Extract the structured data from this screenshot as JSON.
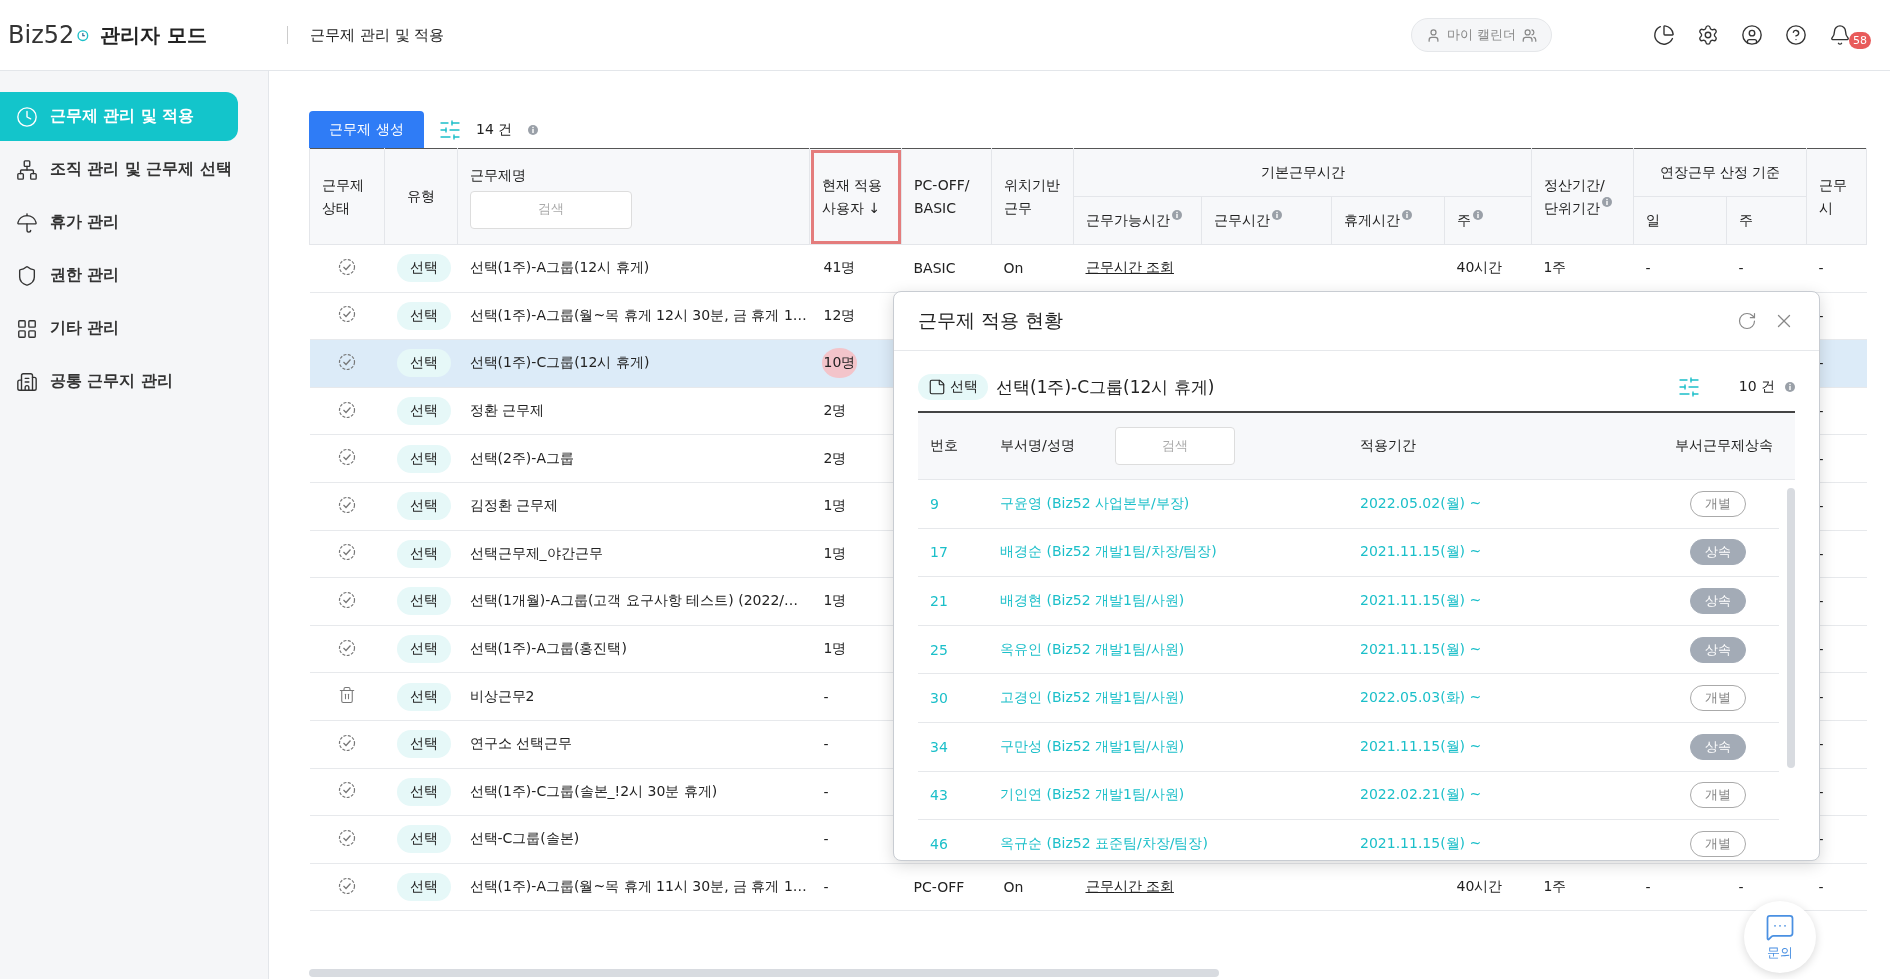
{
  "header": {
    "logo": "Biz52",
    "mode": "관리자 모드",
    "page_title": "근무제 관리 및 적용",
    "calendar_button": "마이 캘린더",
    "notification_count": "58"
  },
  "sidebar": {
    "items": [
      {
        "label": "근무제 관리 및 적용",
        "selected": true
      },
      {
        "label": "조직 관리 및 근무제 선택",
        "selected": false
      },
      {
        "label": "휴가 관리",
        "selected": false
      },
      {
        "label": "권한 관리",
        "selected": false
      },
      {
        "label": "기타 관리",
        "selected": false
      },
      {
        "label": "공통 근무지 관리",
        "selected": false
      }
    ]
  },
  "toolbar": {
    "create_button": "근무제 생성",
    "count": "14 건"
  },
  "table": {
    "columns": [
      {
        "label": "근무제\n상태"
      },
      {
        "label": "유형"
      },
      {
        "label": "근무제명",
        "search_placeholder": "검색"
      },
      {
        "label": "현재 적용\n사용자 ↓",
        "outlined": true
      },
      {
        "label": "PC-OFF/\nBASIC"
      },
      {
        "label": "위치기반\n근무"
      },
      {
        "group": "기본근무시간",
        "children": [
          {
            "label": "근무가능시간",
            "info": true
          },
          {
            "label": "근무시간",
            "info": true
          },
          {
            "label": "휴게시간",
            "info": true
          },
          {
            "label": "주",
            "info": true
          }
        ]
      },
      {
        "label": "정산기간/\n단위기간",
        "info": true
      },
      {
        "group": "연장근무 산정 기준",
        "children": [
          {
            "label": "일"
          },
          {
            "label": "주"
          }
        ]
      },
      {
        "label": "근무시"
      }
    ],
    "rows": [
      {
        "kind": "active",
        "type": "선택",
        "name": "선택(1주)-A그룹(12시 휴게)",
        "users": "41명",
        "mode": "BASIC",
        "location": "On",
        "hours_link": "근무시간 조회",
        "week": "40시간",
        "period": "1주",
        "ot_day": "-",
        "ot_week": "-",
        "last": "-",
        "selected": false,
        "marked": false
      },
      {
        "kind": "active",
        "type": "선택",
        "name": "선택(1주)-A그룹(월~목 휴게 12시 30분, 금 휴게 1…",
        "users": "12명",
        "last": "-",
        "selected": false,
        "marked": false
      },
      {
        "kind": "active",
        "type": "선택",
        "name": "선택(1주)-C그룹(12시 휴게)",
        "users": "10명",
        "last": "-",
        "selected": true,
        "marked": true
      },
      {
        "kind": "active",
        "type": "선택",
        "name": "정환 근무제",
        "users": "2명",
        "last": "-",
        "selected": false,
        "marked": false
      },
      {
        "kind": "active",
        "type": "선택",
        "name": "선택(2주)-A그룹",
        "users": "2명",
        "last": "-",
        "selected": false,
        "marked": false
      },
      {
        "kind": "active",
        "type": "선택",
        "name": "김정환 근무제",
        "users": "1명",
        "last": "-",
        "selected": false,
        "marked": false
      },
      {
        "kind": "active",
        "type": "선택",
        "name": "선택근무제_야간근무",
        "users": "1명",
        "last": "-",
        "selected": false,
        "marked": false
      },
      {
        "kind": "active",
        "type": "선택",
        "name": "선택(1개월)-A그룹(고객 요구사항 테스트) (2022/…",
        "users": "1명",
        "last": "-",
        "selected": false,
        "marked": false
      },
      {
        "kind": "active",
        "type": "선택",
        "name": "선택(1주)-A그룹(홍진택)",
        "users": "1명",
        "last": "-",
        "selected": false,
        "marked": false
      },
      {
        "kind": "deleted",
        "type": "선택",
        "name": "비상근무2",
        "users": "-",
        "last": "-",
        "selected": false,
        "marked": false
      },
      {
        "kind": "active",
        "type": "선택",
        "name": "연구소 선택근무",
        "users": "-",
        "last": "-",
        "selected": false,
        "marked": false
      },
      {
        "kind": "active",
        "type": "선택",
        "name": "선택(1주)-C그룹(솔본_!2시 30분 휴게)",
        "users": "-",
        "last": "-",
        "selected": false,
        "marked": false
      },
      {
        "kind": "active",
        "type": "선택",
        "name": "선택-C그룹(솔본)",
        "users": "-",
        "last": "-",
        "selected": false,
        "marked": false
      },
      {
        "kind": "active",
        "type": "선택",
        "name": "선택(1주)-A그룹(월~목 휴게 11시 30분, 금 휴게 1…",
        "users": "-",
        "mode": "PC-OFF",
        "location": "On",
        "hours_link": "근무시간 조회",
        "week": "40시간",
        "period": "1주",
        "ot_day": "-",
        "ot_week": "-",
        "last": "-",
        "selected": false,
        "marked": false
      }
    ]
  },
  "modal": {
    "title": "근무제 적용 현황",
    "badge": "선택",
    "name": "선택(1주)-C그룹(12시 휴게)",
    "count": "10 건",
    "columns": [
      "번호",
      "부서명/성명",
      "적용기간",
      "부서근무제상속"
    ],
    "search_placeholder": "검색",
    "rows": [
      {
        "no": "9",
        "name": "구윤영 (Biz52 사업본부/부장)",
        "period": "2022.05.02(월) ~",
        "inherit": "개별",
        "kind": "individual"
      },
      {
        "no": "17",
        "name": "배경순 (Biz52 개발1팀/차장/팀장)",
        "period": "2021.11.15(월) ~",
        "inherit": "상속",
        "kind": "inherited"
      },
      {
        "no": "21",
        "name": "배경현 (Biz52 개발1팀/사원)",
        "period": "2021.11.15(월) ~",
        "inherit": "상속",
        "kind": "inherited"
      },
      {
        "no": "25",
        "name": "옥유인 (Biz52 개발1팀/사원)",
        "period": "2021.11.15(월) ~",
        "inherit": "상속",
        "kind": "inherited"
      },
      {
        "no": "30",
        "name": "고경인 (Biz52 개발1팀/사원)",
        "period": "2022.05.03(화) ~",
        "inherit": "개별",
        "kind": "individual"
      },
      {
        "no": "34",
        "name": "구만성 (Biz52 개발1팀/사원)",
        "period": "2021.11.15(월) ~",
        "inherit": "상속",
        "kind": "inherited"
      },
      {
        "no": "43",
        "name": "기인연 (Biz52 개발1팀/사원)",
        "period": "2022.02.21(월) ~",
        "inherit": "개별",
        "kind": "individual"
      },
      {
        "no": "46",
        "name": "옥규순 (Biz52 표준팀/차장/팀장)",
        "period": "2021.11.15(월) ~",
        "inherit": "개별",
        "kind": "individual"
      }
    ]
  },
  "chat_button": "문의"
}
